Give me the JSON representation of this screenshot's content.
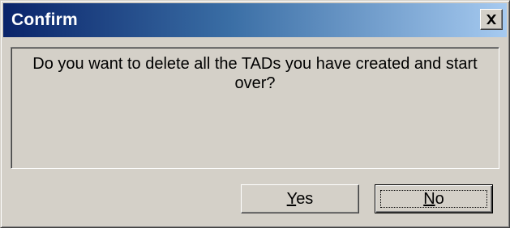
{
  "dialog": {
    "title": "Confirm",
    "close_icon": "close-icon",
    "message": "Do you want to delete all the TADs you have created and start over?",
    "buttons": {
      "yes": {
        "mnemonic": "Y",
        "rest": "es"
      },
      "no": {
        "mnemonic": "N",
        "rest": "o"
      }
    },
    "default_button": "no"
  },
  "colors": {
    "titlebar_start": "#0a246a",
    "titlebar_end": "#a6caf0",
    "face": "#d4d0c8"
  }
}
